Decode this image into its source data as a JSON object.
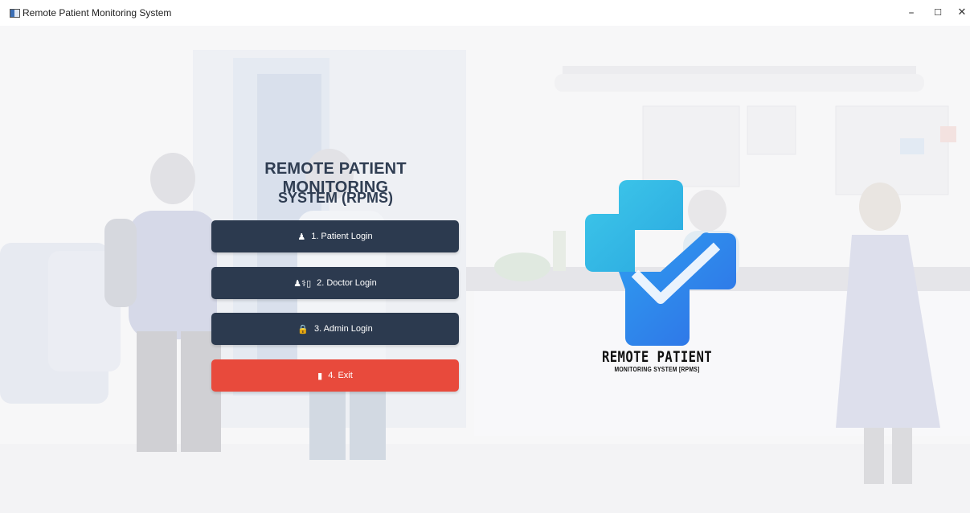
{
  "window": {
    "title": "Remote Patient Monitoring System",
    "controls": {
      "minimize": "–",
      "maximize": "☐",
      "close": "✕"
    }
  },
  "heading": {
    "line1": "REMOTE PATIENT MONITORING",
    "line2": "SYSTEM (RPMS)"
  },
  "menu": {
    "patient": {
      "icon": "patient-icon",
      "glyph": "♟",
      "label": "1. Patient Login"
    },
    "doctor": {
      "icon": "doctor-icon",
      "glyph": "♟⚕▯",
      "label": "2. Doctor Login"
    },
    "admin": {
      "icon": "lock-icon",
      "glyph": "🔒",
      "label": "3. Admin Login"
    },
    "exit": {
      "icon": "door-icon",
      "glyph": "▮",
      "label": "4. Exit"
    }
  },
  "brand": {
    "line1": "REMOTE PATIENT",
    "line2": "MONITORING SYSTEM [RPMS]"
  },
  "colors": {
    "button": "#2c3a4f",
    "exit_button": "#e84a3c",
    "heading": "#2f3d52",
    "logo_cyan": "#3ac4e8",
    "logo_blue": "#2b7de9"
  }
}
